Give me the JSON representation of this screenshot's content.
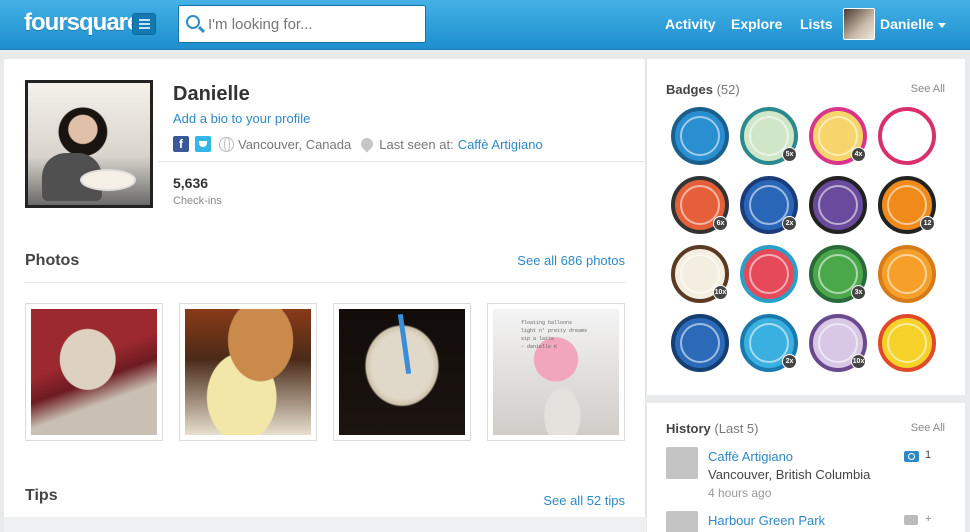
{
  "topbar": {
    "logo": "foursquare",
    "search_placeholder": "I'm looking for...",
    "nav": [
      "Activity",
      "Explore",
      "Lists"
    ],
    "user_name": "Danielle"
  },
  "profile": {
    "name": "Danielle",
    "bio_link": "Add a bio to your profile",
    "location": "Vancouver, Canada",
    "last_seen_label": "Last seen at:",
    "last_seen_venue": "Caffè Artigiano",
    "checkins_count": "5,636",
    "checkins_label": "Check-ins"
  },
  "photos": {
    "title": "Photos",
    "see_all": "See all 686 photos",
    "thumb4_text": [
      "floating balloons",
      "light n' pretty dreams",
      "sip a latte",
      "- danielle K"
    ]
  },
  "tips": {
    "title": "Tips",
    "see_all": "See all 52 tips"
  },
  "badges": {
    "title": "Badges",
    "count": "(52)",
    "see_all": "See All",
    "items": [
      {
        "name": "globe-badge",
        "color": "#2a8fd0",
        "ring": "#1b5f8c",
        "count": ""
      },
      {
        "name": "book-badge",
        "color": "#cfe6c8",
        "ring": "#2a8a8c",
        "count": "5x"
      },
      {
        "name": "cupcake-badge",
        "color": "#f6d66a",
        "ring": "#d8368a",
        "count": "4x"
      },
      {
        "name": "sneaker-badge",
        "color": "#ffffff",
        "ring": "#d8306a",
        "count": ""
      },
      {
        "name": "sushi-badge",
        "color": "#e5603a",
        "ring": "#333333",
        "count": "6x"
      },
      {
        "name": "scissors-badge",
        "color": "#2a66b8",
        "ring": "#1b3c7a",
        "count": "2x"
      },
      {
        "name": "clock-badge",
        "color": "#6a4a9c",
        "ring": "#222222",
        "count": ""
      },
      {
        "name": "pumpkin-badge",
        "color": "#f08a1a",
        "ring": "#222222",
        "count": "12"
      },
      {
        "name": "coffee-badge",
        "color": "#f4eee0",
        "ring": "#5a3a22",
        "count": "10x"
      },
      {
        "name": "camera-badge",
        "color": "#e64a5a",
        "ring": "#2aa0c8",
        "count": ""
      },
      {
        "name": "trees-badge",
        "color": "#4aa84a",
        "ring": "#2a6a3a",
        "count": "3x"
      },
      {
        "name": "backpack-badge",
        "color": "#f6a02a",
        "ring": "#d67a1a",
        "count": ""
      },
      {
        "name": "runner-badge",
        "color": "#2a6ab8",
        "ring": "#173e70",
        "count": ""
      },
      {
        "name": "wave-badge",
        "color": "#3ab0e0",
        "ring": "#1a7ab0",
        "count": "2x"
      },
      {
        "name": "bear-badge",
        "color": "#d8c8e6",
        "ring": "#6a4a8c",
        "count": "10x"
      },
      {
        "name": "sombrero-badge",
        "color": "#f4d22a",
        "ring": "#e04a2a",
        "count": ""
      }
    ]
  },
  "history": {
    "title": "History",
    "subtitle": "(Last 5)",
    "see_all": "See All",
    "items": [
      {
        "venue": "Caffè Artigiano",
        "location": "Vancouver, British Columbia",
        "time": "4 hours ago",
        "photo_count": "1"
      },
      {
        "venue": "Harbour Green Park",
        "location": "",
        "time": "",
        "photo_count": "+"
      }
    ]
  }
}
